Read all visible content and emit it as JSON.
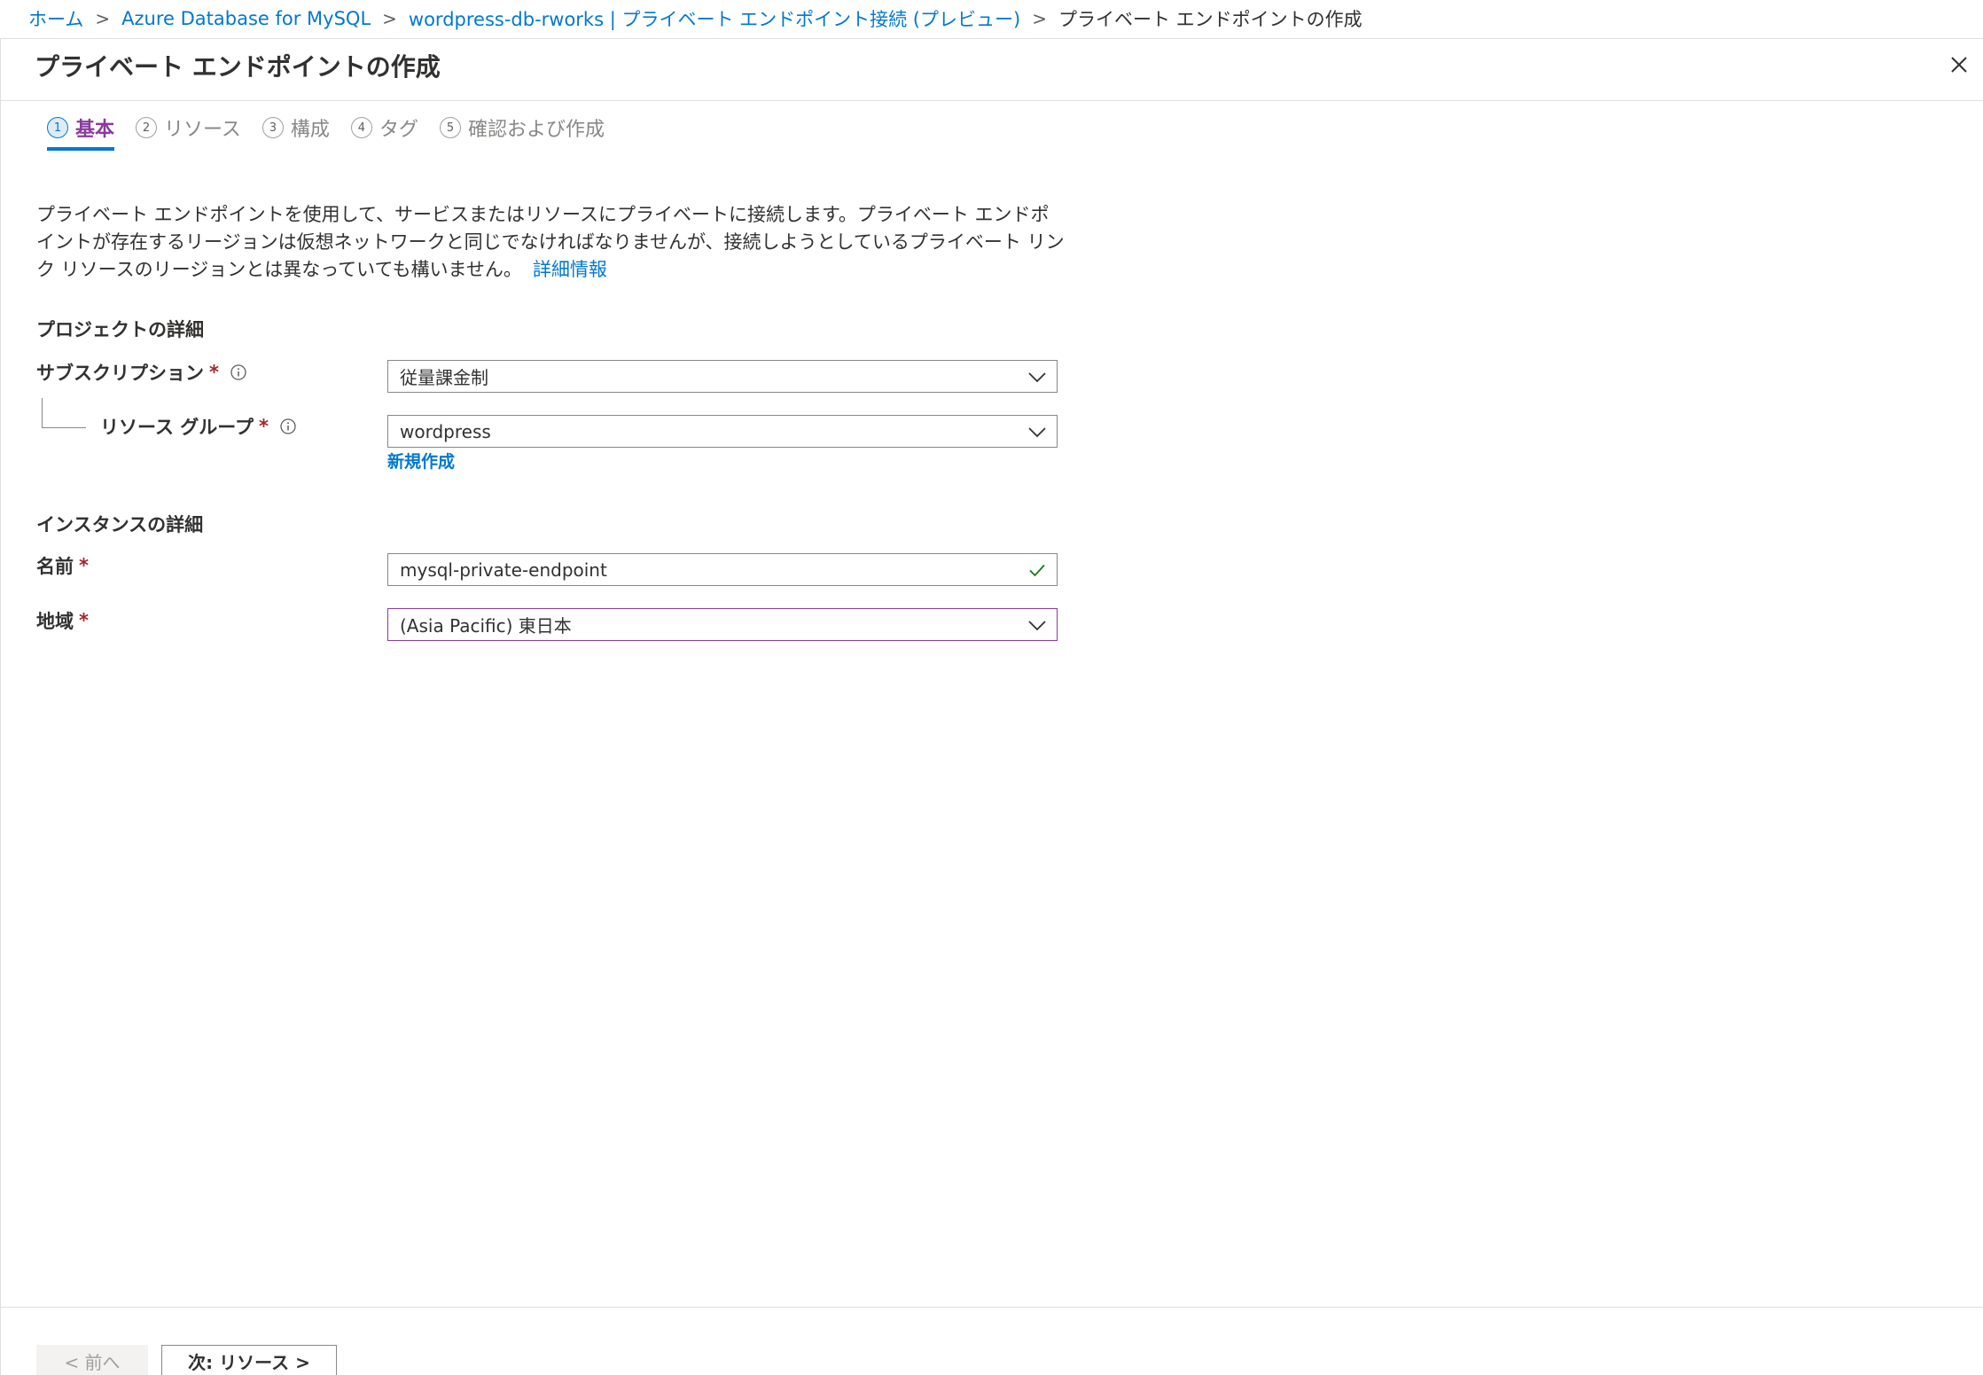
{
  "breadcrumb": {
    "items": [
      "ホーム",
      "Azure Database for MySQL",
      "wordpress-db-rworks | プライベート エンドポイント接続 (プレビュー)"
    ],
    "current": "プライベート エンドポイントの作成",
    "separator": ">"
  },
  "panel": {
    "title": "プライベート エンドポイントの作成"
  },
  "tabs": [
    {
      "num": "1",
      "label": "基本"
    },
    {
      "num": "2",
      "label": "リソース"
    },
    {
      "num": "3",
      "label": "構成"
    },
    {
      "num": "4",
      "label": "タグ"
    },
    {
      "num": "5",
      "label": "確認および作成"
    }
  ],
  "description": {
    "text": "プライベート エンドポイントを使用して、サービスまたはリソースにプライベートに接続します。プライベート エンドポイントが存在するリージョンは仮想ネットワークと同じでなければなりませんが、接続しようとしているプライベート リンク リソースのリージョンとは異なっていても構いません。",
    "learn_more": "詳細情報"
  },
  "project": {
    "section_title": "プロジェクトの詳細",
    "subscription_label": "サブスクリプション",
    "subscription_value": "従量課金制",
    "resource_group_label": "リソース グループ",
    "resource_group_value": "wordpress",
    "create_new": "新規作成"
  },
  "instance": {
    "section_title": "インスタンスの詳細",
    "name_label": "名前",
    "name_value": "mysql-private-endpoint",
    "region_label": "地域",
    "region_value": "(Asia Pacific) 東日本"
  },
  "required_marker": "*",
  "footer": {
    "prev_label": "< 前へ",
    "next_label": "次: リソース >"
  },
  "colors": {
    "accent": "#0078d4",
    "active_tab": "#8a3a9f",
    "required": "#a4262c",
    "valid": "#107c10"
  },
  "icons": {
    "info": "info-icon",
    "dropdown": "chevron-down-icon",
    "valid": "checkmark-icon",
    "close": "close-icon"
  }
}
